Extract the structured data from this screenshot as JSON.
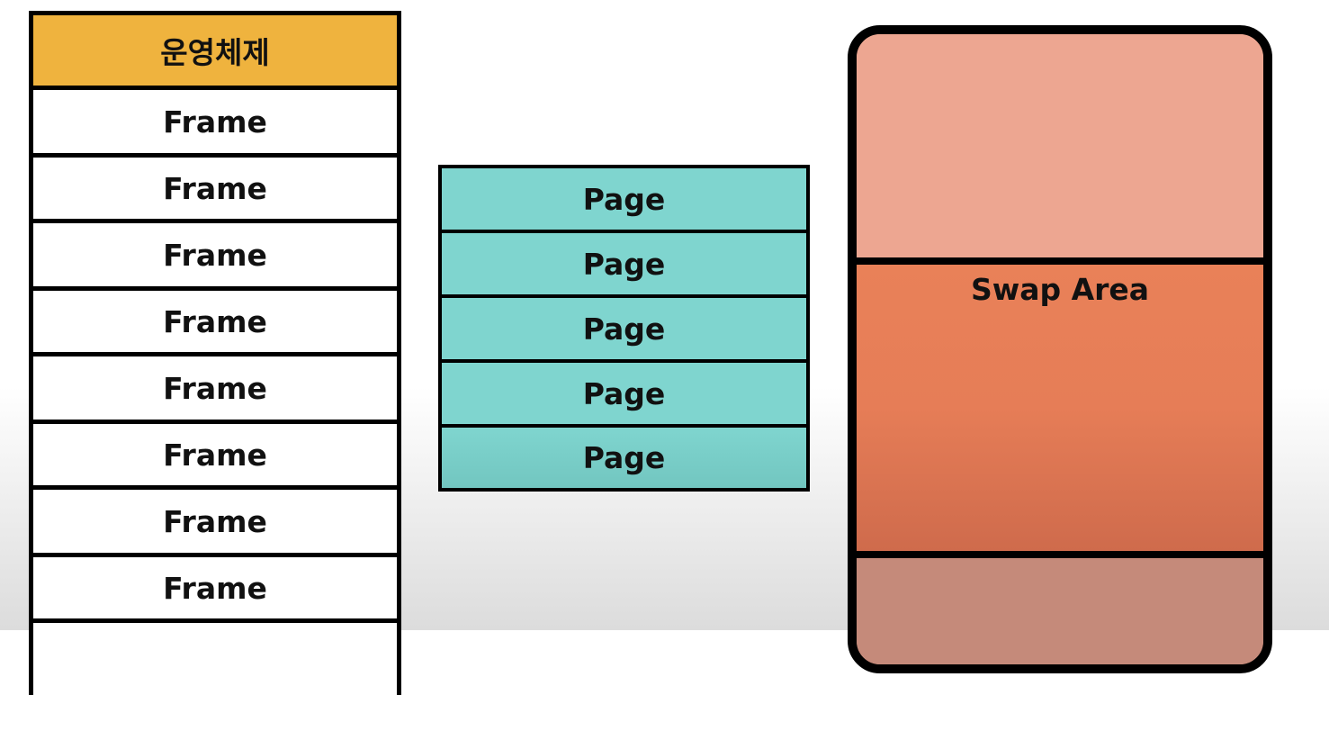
{
  "memory": {
    "os_label": "운영체제",
    "frames": [
      "Frame",
      "Frame",
      "Frame",
      "Frame",
      "Frame",
      "Frame",
      "Frame",
      "Frame"
    ]
  },
  "process": {
    "pages": [
      "Page",
      "Page",
      "Page",
      "Page",
      "Page"
    ]
  },
  "disk": {
    "swap_label": "Swap Area"
  },
  "colors": {
    "os": "#efb33e",
    "frame": "#ffffff",
    "page": "#7fd5cf",
    "disk_top": "#eda691",
    "swap": "#e67d57",
    "disk_bottom": "#c58a7a",
    "border": "#000000"
  }
}
